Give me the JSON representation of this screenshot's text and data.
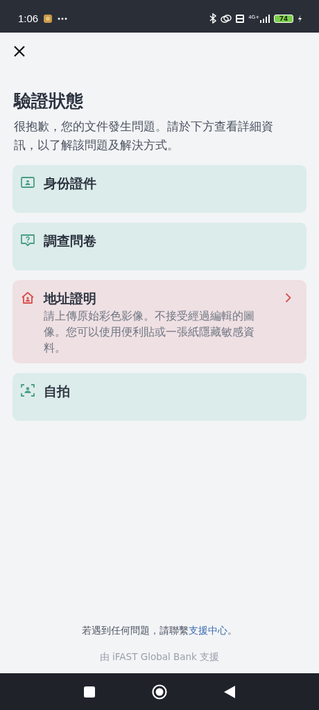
{
  "status_bar": {
    "time": "1:06",
    "network": "4G+",
    "battery": "74"
  },
  "title": "驗證狀態",
  "intro": "很抱歉，您的文件發生問題。請於下方查看詳細資訊，以了解該問題及解決方式。",
  "items": [
    {
      "kind": "id-card",
      "error": false,
      "label": "身份證件"
    },
    {
      "kind": "survey",
      "error": false,
      "label": "調查問卷"
    },
    {
      "kind": "address",
      "error": true,
      "label": "地址證明",
      "message": "請上傳原始彩色影像。不接受經過編輯的圖像。您可以使用便利貼或一張紙隱藏敏感資料。"
    },
    {
      "kind": "selfie",
      "error": false,
      "label": "自拍"
    }
  ],
  "help": {
    "before": "若遇到任何問題，請聯繫",
    "link": "支援中心",
    "after": "。"
  },
  "powered_by": "由 iFAST Global Bank 支援"
}
